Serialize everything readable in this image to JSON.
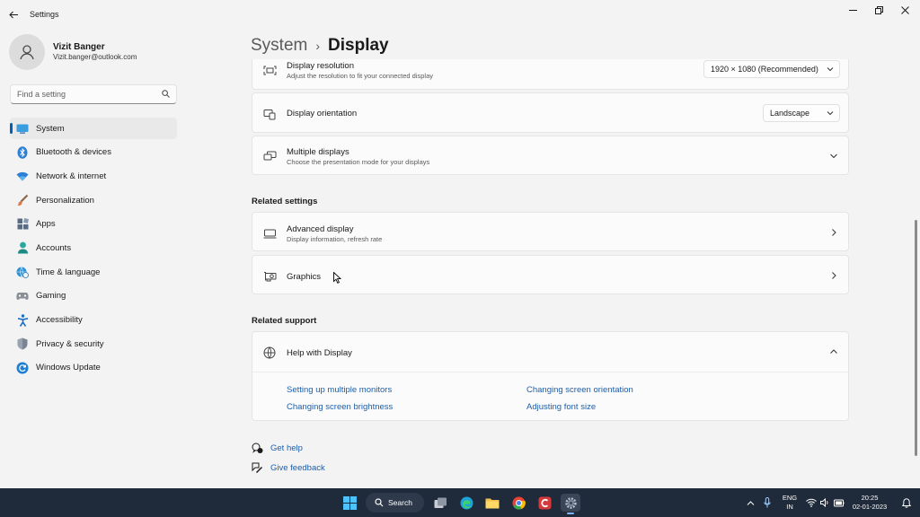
{
  "window": {
    "title": "Settings"
  },
  "profile": {
    "name": "Vizit Banger",
    "email": "Vizit.banger@outlook.com"
  },
  "search": {
    "placeholder": "Find a setting"
  },
  "sidebar": {
    "items": [
      {
        "label": "System",
        "icon": "system-icon",
        "active": true
      },
      {
        "label": "Bluetooth & devices",
        "icon": "bluetooth-icon"
      },
      {
        "label": "Network & internet",
        "icon": "wifi-icon"
      },
      {
        "label": "Personalization",
        "icon": "brush-icon"
      },
      {
        "label": "Apps",
        "icon": "apps-icon"
      },
      {
        "label": "Accounts",
        "icon": "accounts-icon"
      },
      {
        "label": "Time & language",
        "icon": "globe-clock-icon"
      },
      {
        "label": "Gaming",
        "icon": "gamepad-icon"
      },
      {
        "label": "Accessibility",
        "icon": "accessibility-icon"
      },
      {
        "label": "Privacy & security",
        "icon": "shield-icon"
      },
      {
        "label": "Windows Update",
        "icon": "update-icon"
      }
    ]
  },
  "breadcrumb": {
    "parent": "System",
    "separator": "›",
    "current": "Display"
  },
  "display_settings": {
    "resolution": {
      "title": "Display resolution",
      "subtitle": "Adjust the resolution to fit your connected display",
      "value": "1920 × 1080 (Recommended)"
    },
    "orientation": {
      "title": "Display orientation",
      "value": "Landscape"
    },
    "multiple": {
      "title": "Multiple displays",
      "subtitle": "Choose the presentation mode for your displays"
    }
  },
  "related_settings": {
    "header": "Related settings",
    "advanced": {
      "title": "Advanced display",
      "subtitle": "Display information, refresh rate"
    },
    "graphics": {
      "title": "Graphics"
    }
  },
  "related_support": {
    "header": "Related support",
    "help": {
      "title": "Help with Display",
      "links": [
        "Setting up multiple monitors",
        "Changing screen orientation",
        "Changing screen brightness",
        "Adjusting font size"
      ]
    }
  },
  "footer": {
    "get_help": "Get help",
    "give_feedback": "Give feedback"
  },
  "taskbar": {
    "search_label": "Search",
    "lang_top": "ENG",
    "lang_bottom": "IN",
    "time": "20:25",
    "date": "02-01-2023"
  },
  "colors": {
    "accent": "#005fb8",
    "link": "#1d5ea8",
    "taskbar": "#1f2a3a"
  }
}
